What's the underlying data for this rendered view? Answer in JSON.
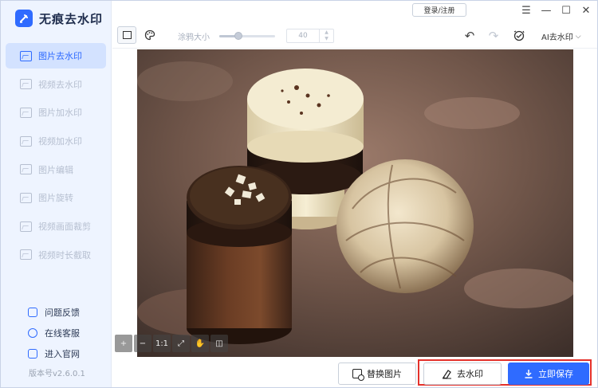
{
  "app": {
    "name": "无痕去水印",
    "version": "版本号v2.6.0.1"
  },
  "colors": {
    "accent": "#2f6bff",
    "sidebar_bg": "#eef4ff",
    "highlight": "#e4312b"
  },
  "sidebar": {
    "items": [
      {
        "label": "图片去水印",
        "active": true
      },
      {
        "label": "视频去水印",
        "active": false
      },
      {
        "label": "图片加水印",
        "active": false
      },
      {
        "label": "视频加水印",
        "active": false
      },
      {
        "label": "图片编辑",
        "active": false
      },
      {
        "label": "图片旋转",
        "active": false
      },
      {
        "label": "视频画面裁剪",
        "active": false
      },
      {
        "label": "视频时长截取",
        "active": false
      }
    ],
    "links": [
      {
        "label": "问题反馈",
        "icon": "feedback-icon"
      },
      {
        "label": "在线客服",
        "icon": "customer-service-icon"
      },
      {
        "label": "进入官网",
        "icon": "website-icon"
      }
    ]
  },
  "titlebar": {
    "login_label": "登录/注册"
  },
  "toolbar": {
    "brush_label": "涂鸦大小",
    "brush_size": "40",
    "brush_level": 0.34,
    "ai_label": "AI去水印"
  },
  "actions": {
    "replace_label": "替换图片",
    "remove_label": "去水印",
    "save_label": "立即保存"
  }
}
